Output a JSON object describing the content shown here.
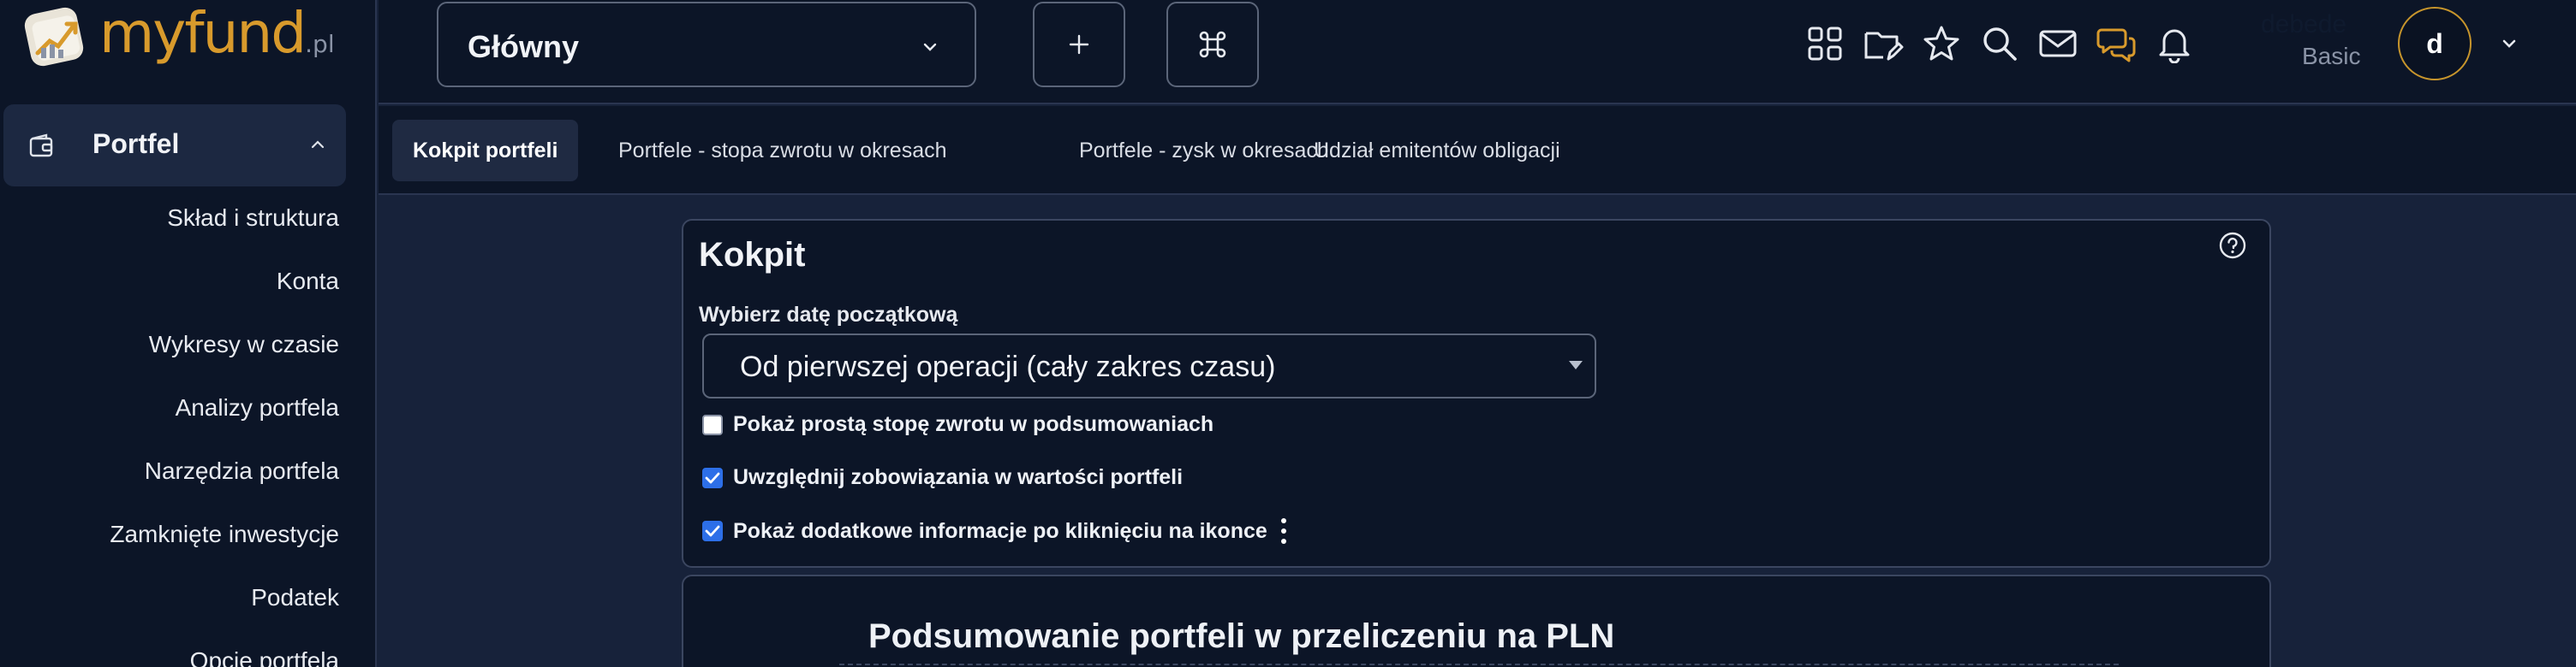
{
  "brand": {
    "logo_main": "myfund",
    "logo_suffix": ".pl"
  },
  "sidebar": {
    "section": {
      "label": "Portfel",
      "icon": "wallet-icon",
      "expanded": true
    },
    "items": [
      {
        "label": "Skład i struktura"
      },
      {
        "label": "Konta"
      },
      {
        "label": "Wykresy w czasie"
      },
      {
        "label": "Analizy portfela"
      },
      {
        "label": "Narzędzia portfela"
      },
      {
        "label": "Zamknięte inwestycje"
      },
      {
        "label": "Podatek"
      },
      {
        "label": "Opcje portfela"
      }
    ]
  },
  "topbar": {
    "portfolio_select": {
      "value": "Główny"
    },
    "add_button_icon": "plus-icon",
    "command_button_icon": "command-icon",
    "icons": [
      "apps-grid-icon",
      "folder-edit-icon",
      "star-icon",
      "search-icon",
      "mail-icon",
      "chat-icon",
      "bell-icon"
    ],
    "user": {
      "name": "debede",
      "plan": "Basic",
      "avatar_initial": "d"
    }
  },
  "tabs": [
    {
      "label": "Kokpit portfeli",
      "active": true
    },
    {
      "label": "Portfele - stopa zwrotu w okresach",
      "active": false
    },
    {
      "label": "Portfele - zysk w okresach",
      "active": false
    },
    {
      "label": "Udział emitentów obligacji",
      "active": false
    }
  ],
  "kokpit": {
    "title": "Kokpit",
    "start_date_label": "Wybierz datę początkową",
    "start_date_value": "Od pierwszej operacji (cały zakres czasu)",
    "options": [
      {
        "label": "Pokaż prostą stopę zwrotu w podsumowaniach",
        "checked": false
      },
      {
        "label": "Uwzględnij zobowiązania w wartości portfeli",
        "checked": true
      },
      {
        "label": "Pokaż dodatkowe informacje po kliknięciu na ikonce",
        "checked": true
      }
    ]
  },
  "summary": {
    "title": "Podsumowanie portfeli w przeliczeniu na PLN"
  },
  "colors": {
    "accent": "#d89a2c",
    "checkbox": "#2d6fe8",
    "background": "#0c1527",
    "page": "#17223a"
  }
}
